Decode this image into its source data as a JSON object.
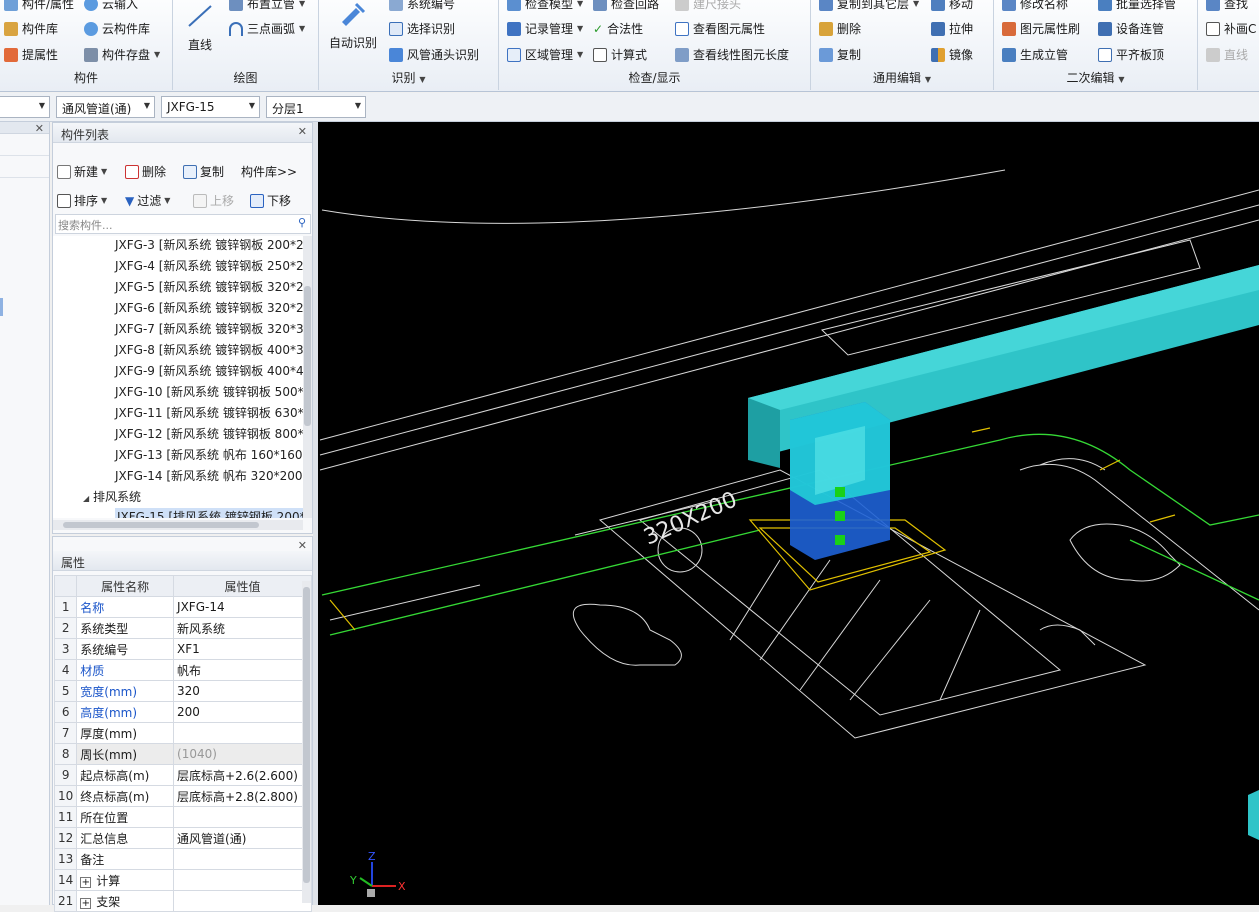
{
  "ribbon": {
    "group1": {
      "items": [
        "构件/属性",
        "构件库",
        "提属性"
      ],
      "right": [
        "云输入",
        "云构件库",
        "构件存盘"
      ],
      "label": "构件"
    },
    "group2": {
      "big": "直线",
      "items": [
        "布置立管",
        "三点画弧"
      ],
      "label": "绘图"
    },
    "group3": {
      "big": "自动识别",
      "items": [
        "系统编号",
        "选择识别",
        "风管通头识别"
      ],
      "label": "识别"
    },
    "group4": {
      "col1": [
        "检查模型",
        "记录管理",
        "区域管理"
      ],
      "col2": [
        "检查回路",
        "合法性",
        "计算式"
      ],
      "col3": [
        "建尺接头",
        "查看图元属性",
        "查看线性图元长度"
      ],
      "label": "检查/显示"
    },
    "group5": {
      "col1": [
        "复制到其它层",
        "删除",
        "复制"
      ],
      "col2": [
        "移动",
        "拉伸",
        "镜像"
      ],
      "label": "通用编辑"
    },
    "group6": {
      "col1": [
        "修改名称",
        "图元属性刷",
        "生成立管"
      ],
      "col2": [
        "批量选择管",
        "设备连管",
        "平齐板顶"
      ],
      "label": "二次编辑"
    },
    "group7": {
      "items": [
        "查找",
        "补画C",
        "直线"
      ]
    }
  },
  "toolbar2": {
    "combo0": "",
    "combo1": "通风管道(通)",
    "combo2": "JXFG-15",
    "combo3": "分层1"
  },
  "comp_list": {
    "title": "构件列表",
    "new": "新建",
    "delete": "删除",
    "copy": "复制",
    "library": "构件库>>",
    "sort": "排序",
    "filter": "过滤",
    "up": "上移",
    "down": "下移",
    "search_placeholder": "搜索构件...",
    "items": [
      "JXFG-3 [新风系统 镀锌钢板 200*2",
      "JXFG-4 [新风系统 镀锌钢板 250*2",
      "JXFG-5 [新风系统 镀锌钢板 320*2",
      "JXFG-6 [新风系统 镀锌钢板 320*2",
      "JXFG-7 [新风系统 镀锌钢板 320*3",
      "JXFG-8 [新风系统 镀锌钢板 400*3",
      "JXFG-9 [新风系统 镀锌钢板 400*4",
      "JXFG-10 [新风系统 镀锌钢板 500*",
      "JXFG-11 [新风系统 镀锌钢板 630*",
      "JXFG-12 [新风系统 镀锌钢板 800*",
      "JXFG-13 [新风系统 帆布 160*160",
      "JXFG-14 [新风系统 帆布 320*200"
    ],
    "group": "排风系统",
    "selected": "JXFG-15 [排风系统 镀锌钢板 200*"
  },
  "props": {
    "title": "属性",
    "col_name": "属性名称",
    "col_value": "属性值",
    "rows": [
      {
        "n": "1",
        "name": "名称",
        "value": "JXFG-14",
        "blue": true
      },
      {
        "n": "2",
        "name": "系统类型",
        "value": "新风系统"
      },
      {
        "n": "3",
        "name": "系统编号",
        "value": "XF1"
      },
      {
        "n": "4",
        "name": "材质",
        "value": "帆布",
        "blue": true
      },
      {
        "n": "5",
        "name": "宽度(mm)",
        "value": "320",
        "blue": true
      },
      {
        "n": "6",
        "name": "高度(mm)",
        "value": "200",
        "blue": true
      },
      {
        "n": "7",
        "name": "厚度(mm)",
        "value": ""
      },
      {
        "n": "8",
        "name": "周长(mm)",
        "value": "(1040)",
        "gray": true
      },
      {
        "n": "9",
        "name": "起点标高(m)",
        "value": "层底标高+2.6(2.600)"
      },
      {
        "n": "10",
        "name": "终点标高(m)",
        "value": "层底标高+2.8(2.800)"
      },
      {
        "n": "11",
        "name": "所在位置",
        "value": ""
      },
      {
        "n": "12",
        "name": "汇总信息",
        "value": "通风管道(通)"
      },
      {
        "n": "13",
        "name": "备注",
        "value": ""
      },
      {
        "n": "14",
        "name": "计算",
        "value": "",
        "expand": true
      },
      {
        "n": "21",
        "name": "支架",
        "value": "",
        "expand": true
      }
    ]
  },
  "viewport": {
    "dim_label": "320X200",
    "axis_x": "X",
    "axis_y": "Y",
    "axis_z": "Z"
  },
  "colors": {
    "duct": "#2fc4c8",
    "selected": "#1e62d6",
    "grip": "#19d119",
    "cad_line": "#d8d8d8",
    "green_line": "#35d835",
    "yellow_line": "#e0c000"
  }
}
